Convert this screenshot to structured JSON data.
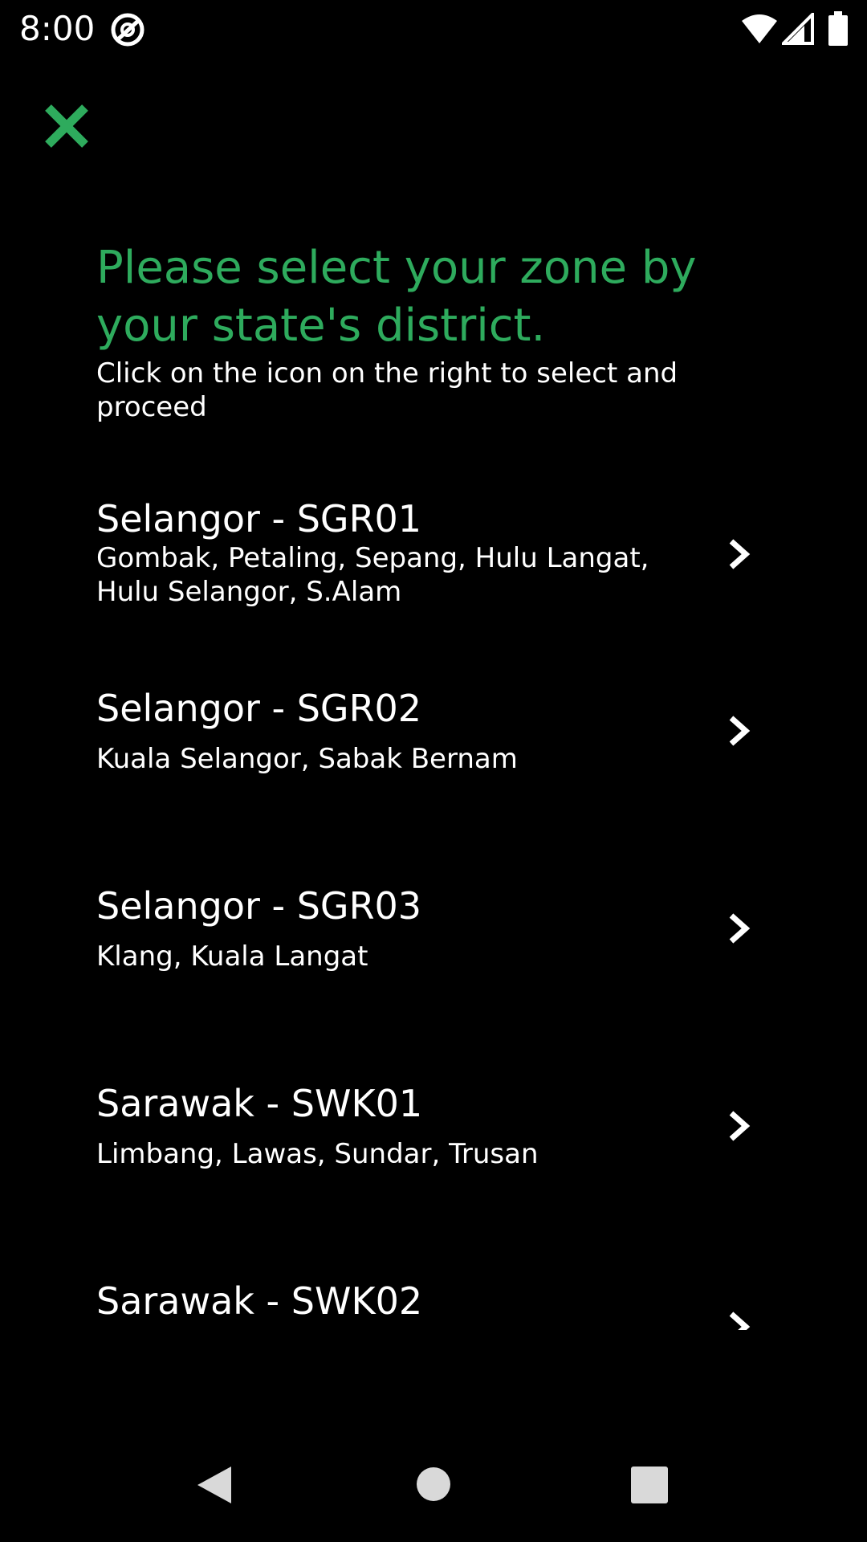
{
  "status_bar": {
    "time": "8:00",
    "icons": [
      "app-notification-icon",
      "wifi-icon",
      "cell-signal-icon",
      "battery-icon"
    ]
  },
  "colors": {
    "accent": "#2eab5d",
    "background": "#000000",
    "text": "#ffffff"
  },
  "header": {
    "close_icon": "close-icon",
    "title": "Please select your zone by your state's district.",
    "subtitle": "Click on the icon on the right to select and proceed"
  },
  "zones": [
    {
      "title": "Selangor - SGR01",
      "districts": "Gombak, Petaling, Sepang, Hulu Langat, Hulu Selangor, S.Alam"
    },
    {
      "title": "Selangor - SGR02",
      "districts": "Kuala Selangor, Sabak Bernam"
    },
    {
      "title": "Selangor - SGR03",
      "districts": "Klang, Kuala Langat"
    },
    {
      "title": "Sarawak - SWK01",
      "districts": "Limbang, Lawas, Sundar, Trusan"
    },
    {
      "title": "Sarawak - SWK02",
      "districts": ""
    }
  ],
  "nav_bar": {
    "icons": [
      "back-icon",
      "home-icon",
      "recents-icon"
    ]
  }
}
